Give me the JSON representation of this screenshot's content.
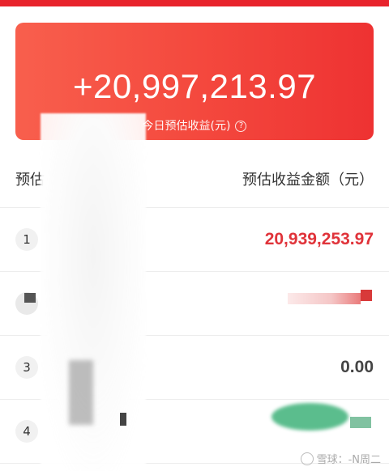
{
  "summary": {
    "amount": "+20,997,213.97",
    "label": "今日预估收益(元)",
    "info_icon": "?"
  },
  "table": {
    "header_left": "预估",
    "header_right": "预估收益金额（元）",
    "rows": [
      {
        "rank": "1",
        "amount": "20,939,253.97"
      },
      {
        "rank": "",
        "amount": ""
      },
      {
        "rank": "3",
        "amount": "0.00"
      },
      {
        "rank": "4",
        "amount": ""
      }
    ]
  },
  "watermark": {
    "text": "雪球：-N周二"
  },
  "colors": {
    "accent_red": "#e0333a",
    "card_gradient_start": "#f85f4d",
    "card_gradient_end": "#ee3232"
  }
}
